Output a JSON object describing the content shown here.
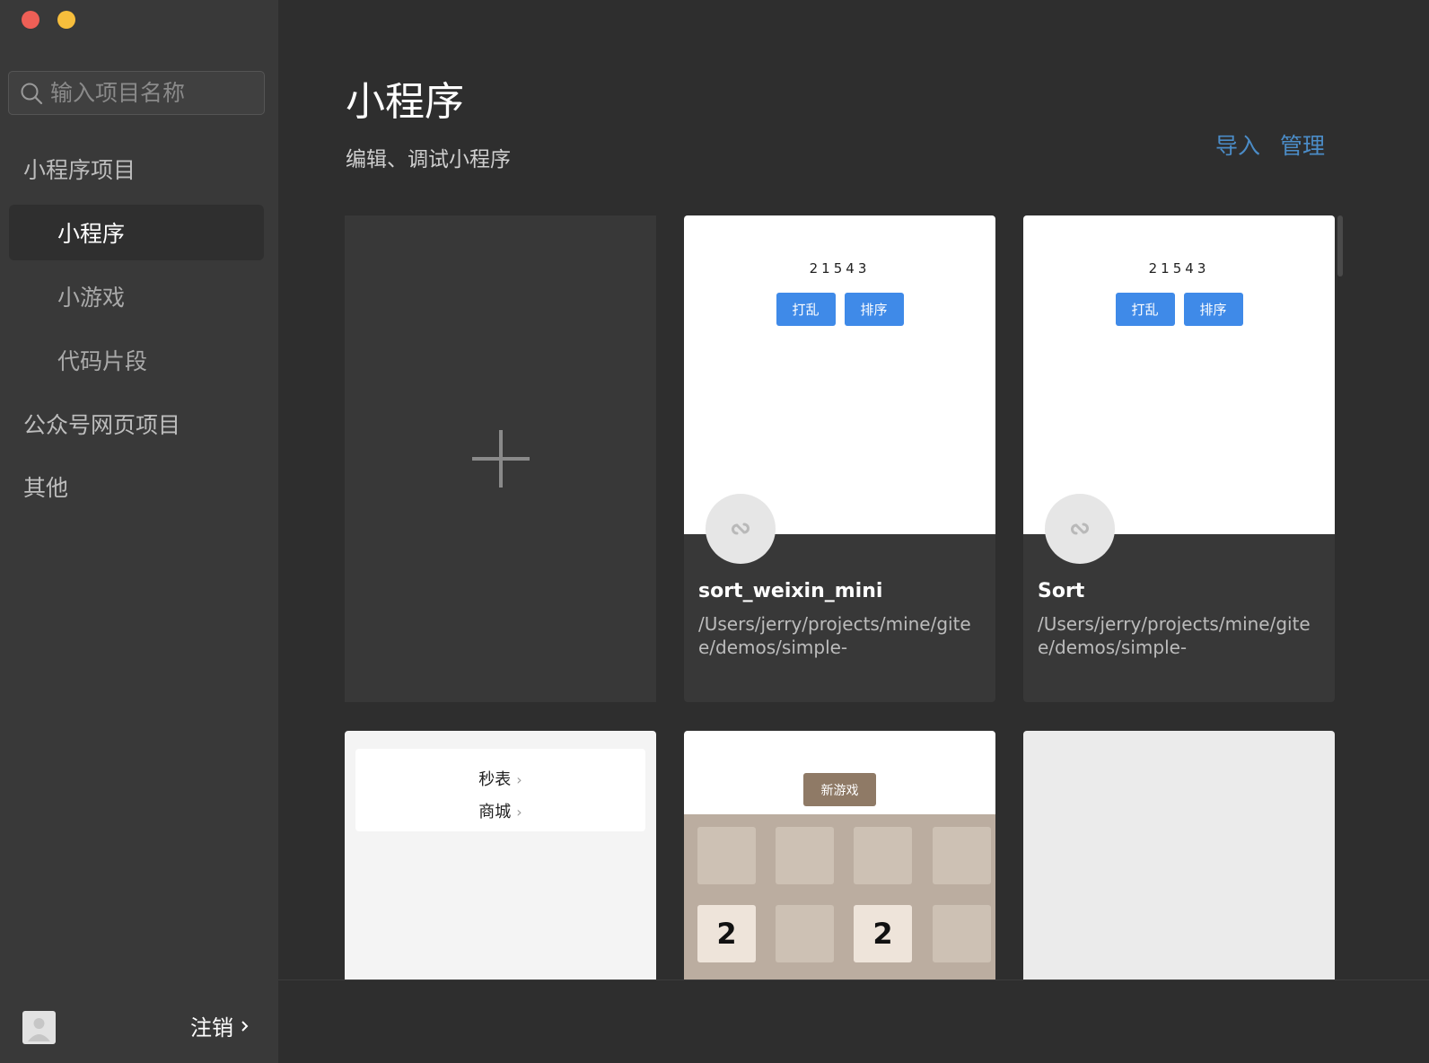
{
  "sidebar": {
    "search_placeholder": "输入项目名称",
    "groups": [
      {
        "label": "小程序项目"
      },
      {
        "label": "公众号网页项目"
      },
      {
        "label": "其他"
      }
    ],
    "items": [
      {
        "label": "小程序",
        "active": true
      },
      {
        "label": "小游戏",
        "active": false
      },
      {
        "label": "代码片段",
        "active": false
      }
    ],
    "logout_label": "注销"
  },
  "header": {
    "title": "小程序",
    "subtitle": "编辑、调试小程序",
    "import_label": "导入",
    "manage_label": "管理"
  },
  "projects": [
    {
      "preview_sequence": "21543",
      "preview_buttons": [
        "打乱",
        "排序"
      ],
      "name": "sort_weixin_mini",
      "path": "/Users/jerry/projects/mine/gitee/demos/simple-"
    },
    {
      "preview_sequence": "21543",
      "preview_buttons": [
        "打乱",
        "排序"
      ],
      "name": "Sort",
      "path": "/Users/jerry/projects/mine/gitee/demos/simple-"
    }
  ],
  "row2": {
    "menu_items": [
      "秒表",
      "商城"
    ],
    "game_button": "新游戏",
    "tiles": [
      "",
      "",
      "",
      "",
      "2",
      "",
      "2",
      ""
    ]
  },
  "colors": {
    "accent_link": "#4b8cc7",
    "preview_button": "#3f8ae8",
    "sidebar_bg": "#393939",
    "main_bg": "#2e2e2e"
  }
}
